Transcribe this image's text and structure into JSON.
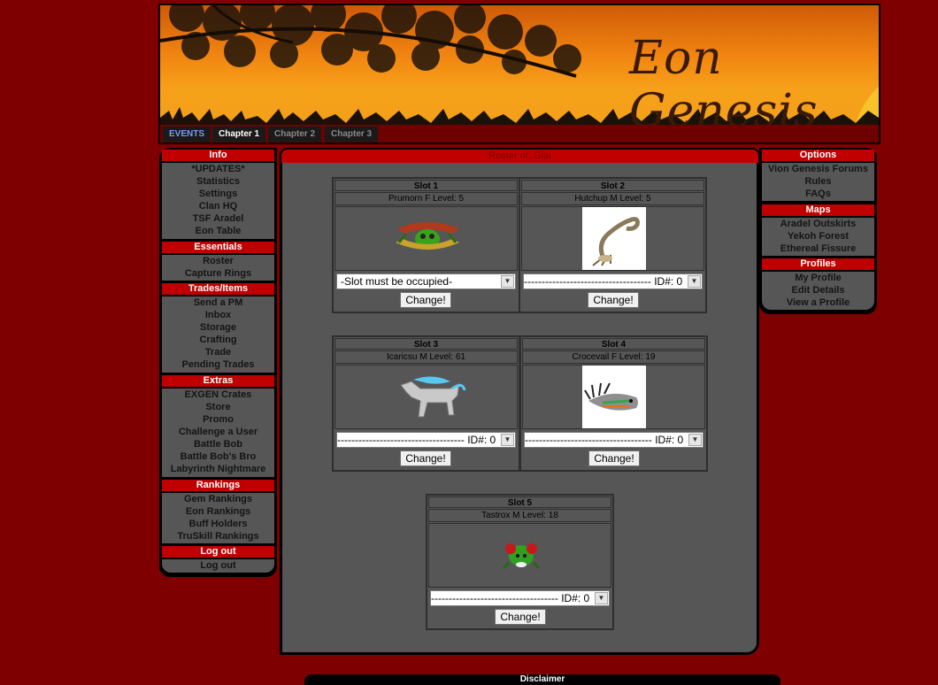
{
  "site": {
    "title": "Eon Genesis"
  },
  "chapters": [
    {
      "label": "EVENTS"
    },
    {
      "label": "Chapter 1"
    },
    {
      "label": "Chapter 2"
    },
    {
      "label": "Chapter 3"
    }
  ],
  "left_menu": {
    "info": {
      "title": "Info",
      "items": [
        "*UPDATES*",
        "Statistics",
        "Settings",
        "Clan HQ",
        "TSF Aradel",
        "Eon Table"
      ]
    },
    "essentials": {
      "title": "Essentials",
      "items": [
        "Roster",
        "Capture Rings"
      ]
    },
    "trades": {
      "title": "Trades/Items",
      "items": [
        "Send a PM",
        "Inbox",
        "Storage",
        "Crafting",
        "Trade",
        "Pending Trades"
      ]
    },
    "extras": {
      "title": "Extras",
      "items": [
        "EXGEN Crates",
        "Store",
        "Promo",
        "Challenge a User",
        "Battle Bob",
        "Battle Bob's Bro",
        "Labyrinth Nightmare"
      ]
    },
    "rankings": {
      "title": "Rankings",
      "items": [
        "Gem Rankings",
        "Eon Rankings",
        "Buff Holders",
        "TruSkill Rankings"
      ]
    },
    "logout": {
      "title": "Log out",
      "items": [
        "Log out"
      ]
    }
  },
  "right_menu": {
    "options": {
      "title": "Options",
      "items": [
        "Vion Genesis Forums",
        "Rules",
        "FAQs"
      ]
    },
    "maps": {
      "title": "Maps",
      "items": [
        "Aradel Outskirts",
        "Yekoh Forest",
        "Ethereal Fissure"
      ]
    },
    "profiles": {
      "title": "Profiles",
      "items": [
        "My Profile",
        "Edit Details",
        "View a Profile"
      ]
    }
  },
  "roster": {
    "title": "Roster of: Glai",
    "button_label": "Change!",
    "slots": [
      {
        "title": "Slot 1",
        "info": "Prumorn F Level: 5",
        "select": "-Slot must be occupied-",
        "sprite": "green-crab-sprite"
      },
      {
        "title": "Slot 2",
        "info": "Hutchup M Level: 5",
        "select": "------------------------------------ ID#: 0",
        "sprite": "scorpion-sprite"
      },
      {
        "title": "Slot 3",
        "info": "Icaricsu M Level: 61",
        "select": "------------------------------------ ID#: 0",
        "sprite": "ice-wolf-sprite"
      },
      {
        "title": "Slot 4",
        "info": "Crocevail F Level: 19",
        "select": "------------------------------------ ID#: 0",
        "sprite": "fish-sprite"
      },
      {
        "title": "Slot 5",
        "info": "Tastrox M Level: 18",
        "select": "------------------------------------ ID#: 0",
        "sprite": "green-bug-sprite"
      }
    ]
  },
  "footer": {
    "disclaimer": "Disclaimer"
  },
  "colors": {
    "background": "#7f0000",
    "section_red": "#c00000",
    "panel_gray": "#565656",
    "events_blue": "#7b9bff"
  }
}
